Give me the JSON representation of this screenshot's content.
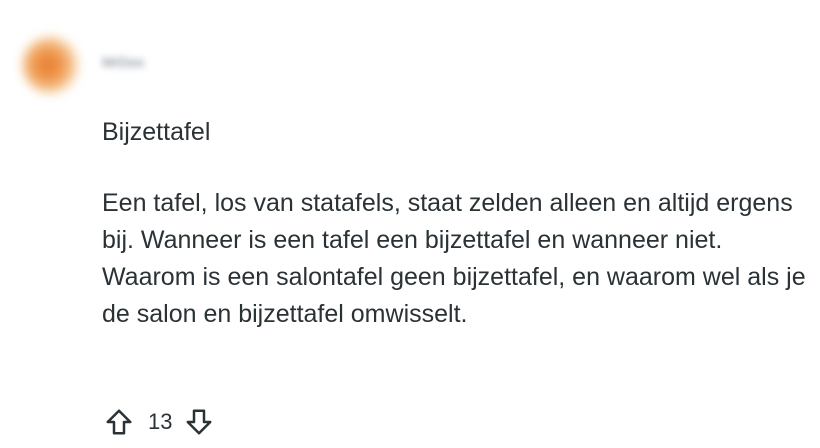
{
  "comment": {
    "username": "MrDoo",
    "title": "Bijzettafel",
    "body": "Een tafel, los van statafels, staat zelden alleen en altijd ergens bij. Wanneer is een tafel een bijzettafel en wanneer niet. Waarom is een salontafel geen bijzettafel, en waarom wel als je de salon en bijzettafel omwisselt.",
    "score": "13"
  },
  "icons": {
    "upvote": "upvote-arrow-icon",
    "downvote": "downvote-arrow-icon"
  },
  "colors": {
    "text": "#2a3236",
    "avatar_accent": "#e8792c"
  }
}
